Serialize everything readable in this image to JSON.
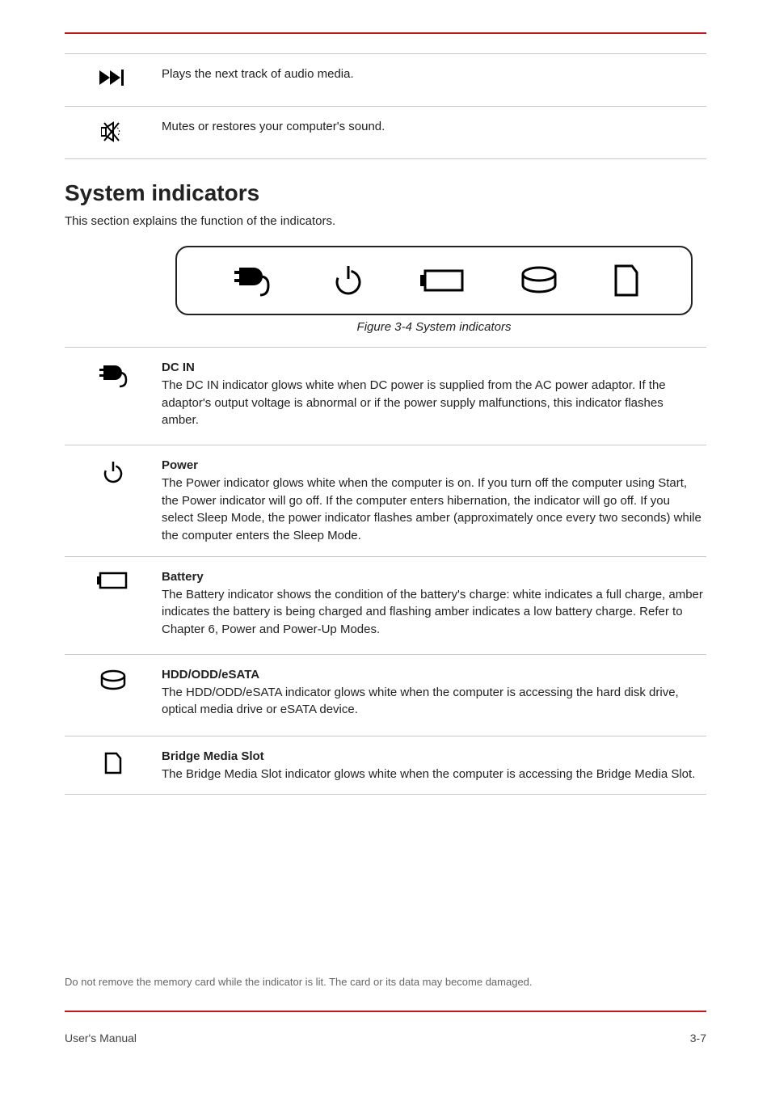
{
  "hotkey_rows": [
    {
      "icon": "next-track-icon",
      "label": "Plays the next track of audio media."
    },
    {
      "icon": "mute-icon",
      "label": "Mutes or restores your computer's sound."
    }
  ],
  "section": {
    "title": "System indicators",
    "subtitle": "This section explains the function of the indicators.",
    "figure_caption": "Figure 3-4 System indicators",
    "figure_icons": [
      "plug-icon",
      "power-icon",
      "battery-icon",
      "disk-icon",
      "card-icon"
    ]
  },
  "indicator_rows": [
    {
      "icon": "plug-icon",
      "title": "DC IN",
      "body": "The DC IN indicator glows white when DC power is supplied from the AC power adaptor. If the adaptor's output voltage is abnormal or if the power supply malfunctions, this indicator flashes amber."
    },
    {
      "icon": "power-icon",
      "title": "Power",
      "body": "The Power indicator glows white when the computer is on. If you turn off the computer using Start, the Power indicator will go off. If the computer enters hibernation, the indicator will go off. If you select Sleep Mode, the power indicator flashes amber (approximately once every two seconds) while the computer enters the Sleep Mode."
    },
    {
      "icon": "battery-icon",
      "title": "Battery",
      "body": "The Battery indicator shows the condition of the battery's charge: white indicates a full charge, amber indicates the battery is being charged and flashing amber indicates a low battery charge. Refer to Chapter 6, Power and Power-Up Modes."
    },
    {
      "icon": "disk-icon",
      "title": "HDD/ODD/eSATA",
      "body": "The HDD/ODD/eSATA indicator glows white when the computer is accessing the hard disk drive, optical media drive or eSATA device."
    },
    {
      "icon": "card-icon",
      "title": "Bridge Media Slot",
      "body": "The Bridge Media Slot indicator glows white when the computer is accessing the Bridge Media Slot."
    }
  ],
  "warning": "Do not remove the memory card while the indicator is lit. The card or its data may become damaged.",
  "footer": {
    "left": "User's Manual",
    "right": "3-7"
  }
}
